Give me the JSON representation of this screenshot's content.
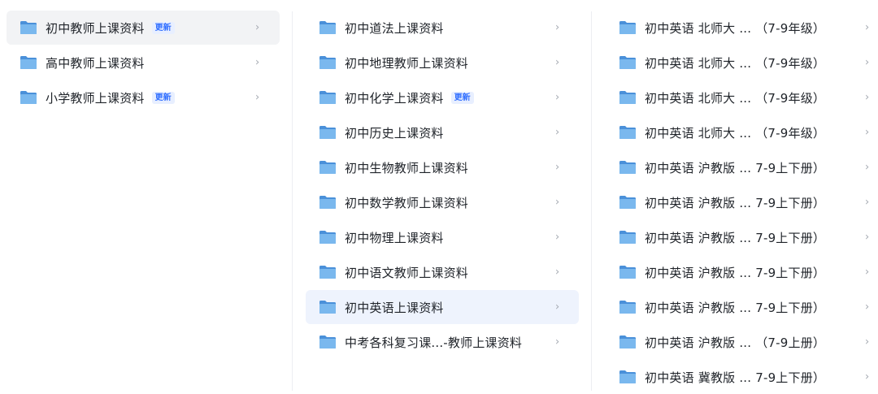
{
  "column1": {
    "items": [
      {
        "label": "初中教师上课资料",
        "badge": "更新",
        "chevron": "›"
      },
      {
        "label": "高中教师上课资料",
        "badge": "",
        "chevron": "›"
      },
      {
        "label": "小学教师上课资料",
        "badge": "更新",
        "chevron": "›"
      }
    ],
    "active_index": 0
  },
  "column2": {
    "items": [
      {
        "label": "初中道法上课资料",
        "badge": "",
        "chevron": "›"
      },
      {
        "label": "初中地理教师上课资料",
        "badge": "",
        "chevron": "›"
      },
      {
        "label": "初中化学上课资料",
        "badge": "更新",
        "chevron": "›"
      },
      {
        "label": "初中历史上课资料",
        "badge": "",
        "chevron": "›"
      },
      {
        "label": "初中生物教师上课资料",
        "badge": "",
        "chevron": "›"
      },
      {
        "label": "初中数学教师上课资料",
        "badge": "",
        "chevron": "›"
      },
      {
        "label": "初中物理上课资料",
        "badge": "",
        "chevron": "›"
      },
      {
        "label": "初中语文教师上课资料",
        "badge": "",
        "chevron": "›"
      },
      {
        "label": "初中英语上课资料",
        "badge": "",
        "chevron": "›"
      },
      {
        "label": "中考各科复习课...-教师上课资料",
        "badge": "",
        "chevron": "›"
      }
    ],
    "selected_index": 8
  },
  "column3": {
    "items": [
      {
        "label": "初中英语 北师大 ... （7-9年级）",
        "chevron": "›"
      },
      {
        "label": "初中英语 北师大 ... （7-9年级）",
        "chevron": "›"
      },
      {
        "label": "初中英语 北师大 ... （7-9年级）",
        "chevron": "›"
      },
      {
        "label": "初中英语 北师大 ... （7-9年级）",
        "chevron": "›"
      },
      {
        "label": "初中英语 沪教版 ... 7-9上下册）",
        "chevron": "›"
      },
      {
        "label": "初中英语 沪教版 ... 7-9上下册）",
        "chevron": "›"
      },
      {
        "label": "初中英语 沪教版 ... 7-9上下册）",
        "chevron": "›"
      },
      {
        "label": "初中英语 沪教版 ... 7-9上下册）",
        "chevron": "›"
      },
      {
        "label": "初中英语 沪教版 ... 7-9上下册）",
        "chevron": "›"
      },
      {
        "label": "初中英语 沪教版 ... （7-9上册）",
        "chevron": "›"
      },
      {
        "label": "初中英语 冀教版 ... 7-9上下册）",
        "chevron": "›"
      }
    ]
  },
  "icons": {
    "folder": "folder-icon",
    "chevron": "chevron-right-icon"
  },
  "colors": {
    "folder_back": "#4a90d9",
    "folder_front": "#7ab8ee",
    "badge_text": "#3370ff",
    "badge_bg": "#e8efff",
    "active_bg": "#f2f3f5",
    "selected_bg": "#eef3fd"
  }
}
